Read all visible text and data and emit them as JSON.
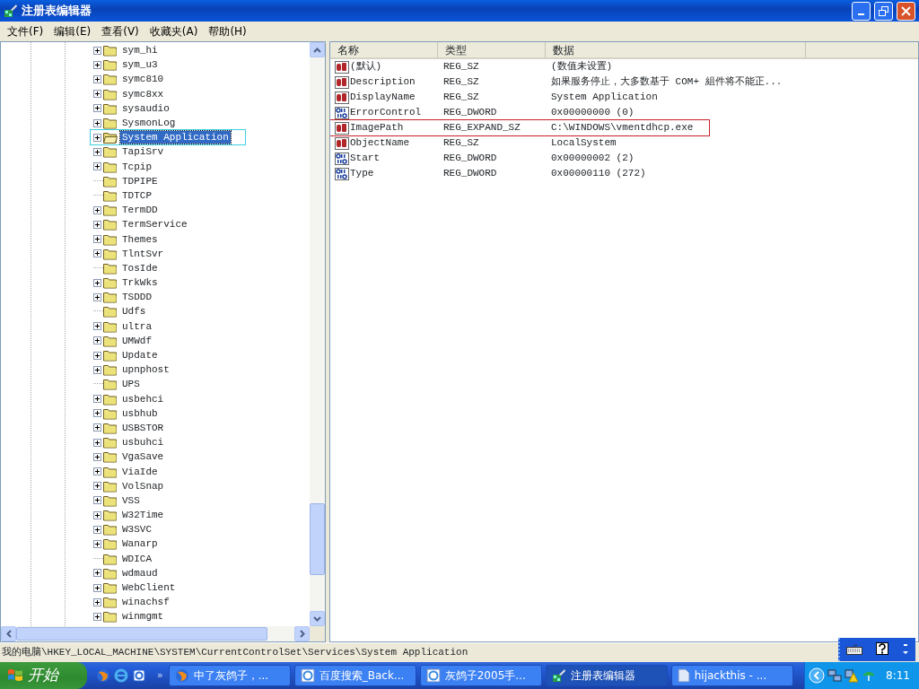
{
  "window": {
    "title": "注册表编辑器"
  },
  "menu": [
    "文件(F)",
    "编辑(E)",
    "查看(V)",
    "收藏夹(A)",
    "帮助(H)"
  ],
  "tree": {
    "items": [
      {
        "label": "sym_hi",
        "has_children": true,
        "selected": false,
        "outlined": false
      },
      {
        "label": "sym_u3",
        "has_children": true,
        "selected": false,
        "outlined": false
      },
      {
        "label": "symc810",
        "has_children": true,
        "selected": false,
        "outlined": false
      },
      {
        "label": "symc8xx",
        "has_children": true,
        "selected": false,
        "outlined": false
      },
      {
        "label": "sysaudio",
        "has_children": true,
        "selected": false,
        "outlined": false
      },
      {
        "label": "SysmonLog",
        "has_children": true,
        "selected": false,
        "outlined": false
      },
      {
        "label": "System Application",
        "has_children": true,
        "selected": true,
        "outlined": true
      },
      {
        "label": "TapiSrv",
        "has_children": true,
        "selected": false,
        "outlined": false
      },
      {
        "label": "Tcpip",
        "has_children": true,
        "selected": false,
        "outlined": false
      },
      {
        "label": "TDPIPE",
        "has_children": false,
        "selected": false,
        "outlined": false
      },
      {
        "label": "TDTCP",
        "has_children": false,
        "selected": false,
        "outlined": false
      },
      {
        "label": "TermDD",
        "has_children": true,
        "selected": false,
        "outlined": false
      },
      {
        "label": "TermService",
        "has_children": true,
        "selected": false,
        "outlined": false
      },
      {
        "label": "Themes",
        "has_children": true,
        "selected": false,
        "outlined": false
      },
      {
        "label": "TlntSvr",
        "has_children": true,
        "selected": false,
        "outlined": false
      },
      {
        "label": "TosIde",
        "has_children": false,
        "selected": false,
        "outlined": false
      },
      {
        "label": "TrkWks",
        "has_children": true,
        "selected": false,
        "outlined": false
      },
      {
        "label": "TSDDD",
        "has_children": true,
        "selected": false,
        "outlined": false
      },
      {
        "label": "Udfs",
        "has_children": false,
        "selected": false,
        "outlined": false
      },
      {
        "label": "ultra",
        "has_children": true,
        "selected": false,
        "outlined": false
      },
      {
        "label": "UMWdf",
        "has_children": true,
        "selected": false,
        "outlined": false
      },
      {
        "label": "Update",
        "has_children": true,
        "selected": false,
        "outlined": false
      },
      {
        "label": "upnphost",
        "has_children": true,
        "selected": false,
        "outlined": false
      },
      {
        "label": "UPS",
        "has_children": false,
        "selected": false,
        "outlined": false
      },
      {
        "label": "usbehci",
        "has_children": true,
        "selected": false,
        "outlined": false
      },
      {
        "label": "usbhub",
        "has_children": true,
        "selected": false,
        "outlined": false
      },
      {
        "label": "USBSTOR",
        "has_children": true,
        "selected": false,
        "outlined": false
      },
      {
        "label": "usbuhci",
        "has_children": true,
        "selected": false,
        "outlined": false
      },
      {
        "label": "VgaSave",
        "has_children": true,
        "selected": false,
        "outlined": false
      },
      {
        "label": "ViaIde",
        "has_children": true,
        "selected": false,
        "outlined": false
      },
      {
        "label": "VolSnap",
        "has_children": true,
        "selected": false,
        "outlined": false
      },
      {
        "label": "VSS",
        "has_children": true,
        "selected": false,
        "outlined": false
      },
      {
        "label": "W32Time",
        "has_children": true,
        "selected": false,
        "outlined": false
      },
      {
        "label": "W3SVC",
        "has_children": true,
        "selected": false,
        "outlined": false
      },
      {
        "label": "Wanarp",
        "has_children": true,
        "selected": false,
        "outlined": false
      },
      {
        "label": "WDICA",
        "has_children": false,
        "selected": false,
        "outlined": false
      },
      {
        "label": "wdmaud",
        "has_children": true,
        "selected": false,
        "outlined": false
      },
      {
        "label": "WebClient",
        "has_children": true,
        "selected": false,
        "outlined": false
      },
      {
        "label": "winachsf",
        "has_children": true,
        "selected": false,
        "outlined": false
      },
      {
        "label": "winmgmt",
        "has_children": true,
        "selected": false,
        "outlined": false
      }
    ]
  },
  "values": {
    "columns": [
      "名称",
      "类型",
      "数据"
    ],
    "rows": [
      {
        "kind": "string",
        "name": "(默认)",
        "type": "REG_SZ",
        "data": "(数值未设置)",
        "outlined": false
      },
      {
        "kind": "string",
        "name": "Description",
        "type": "REG_SZ",
        "data": "如果服务停止，大多数基于 COM+ 組件将不能正...",
        "outlined": false
      },
      {
        "kind": "string",
        "name": "DisplayName",
        "type": "REG_SZ",
        "data": "System Application",
        "outlined": false
      },
      {
        "kind": "dword",
        "name": "ErrorControl",
        "type": "REG_DWORD",
        "data": "0x00000000 (0)",
        "outlined": false
      },
      {
        "kind": "string",
        "name": "ImagePath",
        "type": "REG_EXPAND_SZ",
        "data": "C:\\WINDOWS\\vmentdhcp.exe",
        "outlined": true
      },
      {
        "kind": "string",
        "name": "ObjectName",
        "type": "REG_SZ",
        "data": "LocalSystem",
        "outlined": false
      },
      {
        "kind": "dword",
        "name": "Start",
        "type": "REG_DWORD",
        "data": "0x00000002 (2)",
        "outlined": false
      },
      {
        "kind": "dword",
        "name": "Type",
        "type": "REG_DWORD",
        "data": "0x00000110 (272)",
        "outlined": false
      }
    ]
  },
  "status_bar": "我的电脑\\HKEY_LOCAL_MACHINE\\SYSTEM\\CurrentControlSet\\Services\\System Application",
  "taskbar": {
    "start": "开始",
    "more": "»",
    "tasks": [
      {
        "kind": "browser",
        "label": "中了灰鸽子，...",
        "selected": false
      },
      {
        "kind": "ie",
        "label": "百度搜索_Back...",
        "selected": false
      },
      {
        "kind": "ie",
        "label": "灰鸽子2005手...",
        "selected": false
      },
      {
        "kind": "regedit",
        "label": "注册表编辑器",
        "selected": true
      },
      {
        "kind": "document",
        "label": "hijackthis - ...",
        "selected": false
      }
    ],
    "clock": "8:11"
  }
}
